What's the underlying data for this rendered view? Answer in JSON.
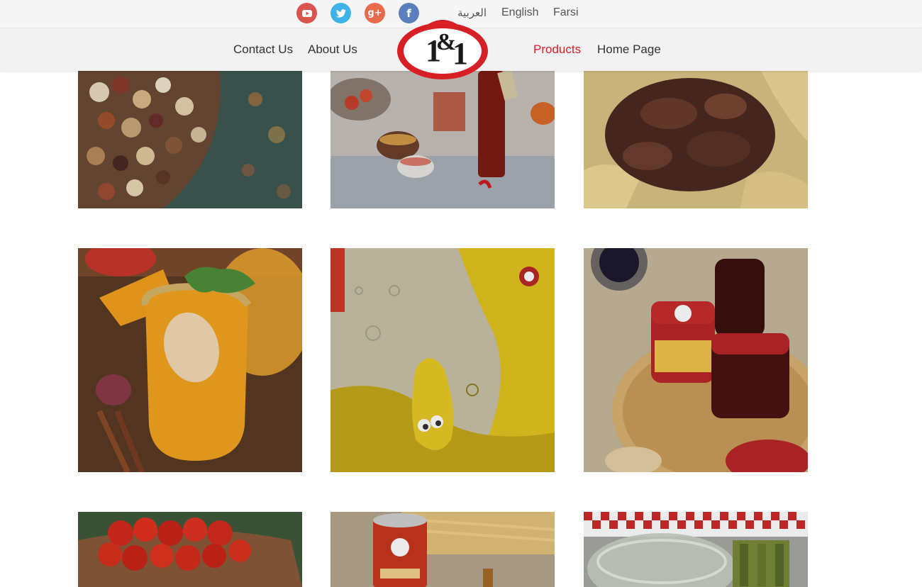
{
  "social": [
    {
      "name": "youtube-icon",
      "color": "#d9534f",
      "glyph": "▶"
    },
    {
      "name": "twitter-icon",
      "color": "#3fb3e8",
      "glyph": "t"
    },
    {
      "name": "google-plus-icon",
      "color": "#ea6a4c",
      "glyph": "g+"
    },
    {
      "name": "facebook-icon",
      "color": "#5b7fbd",
      "glyph": "f"
    }
  ],
  "languages": {
    "arabic": "العربية",
    "english": "English",
    "farsi": "Farsi"
  },
  "nav": {
    "contact": "Contact Us",
    "about": "About Us",
    "products": "Products",
    "home": "Home Page"
  },
  "logo": {
    "text_left": "1",
    "text_amp": "&",
    "text_right": "1",
    "color": "#d71f26"
  },
  "products": [
    {
      "name": "legumes"
    },
    {
      "name": "ketchup"
    },
    {
      "name": "meat-pasta"
    },
    {
      "name": "juice-drink"
    },
    {
      "name": "oil"
    },
    {
      "name": "jam"
    },
    {
      "name": "tomatoes"
    },
    {
      "name": "tomato-paste"
    },
    {
      "name": "pickles"
    }
  ],
  "colors": {
    "accent": "#d71f26",
    "topbar_bg": "#f5f5f5",
    "navbar_bg": "#f2f2f2"
  }
}
